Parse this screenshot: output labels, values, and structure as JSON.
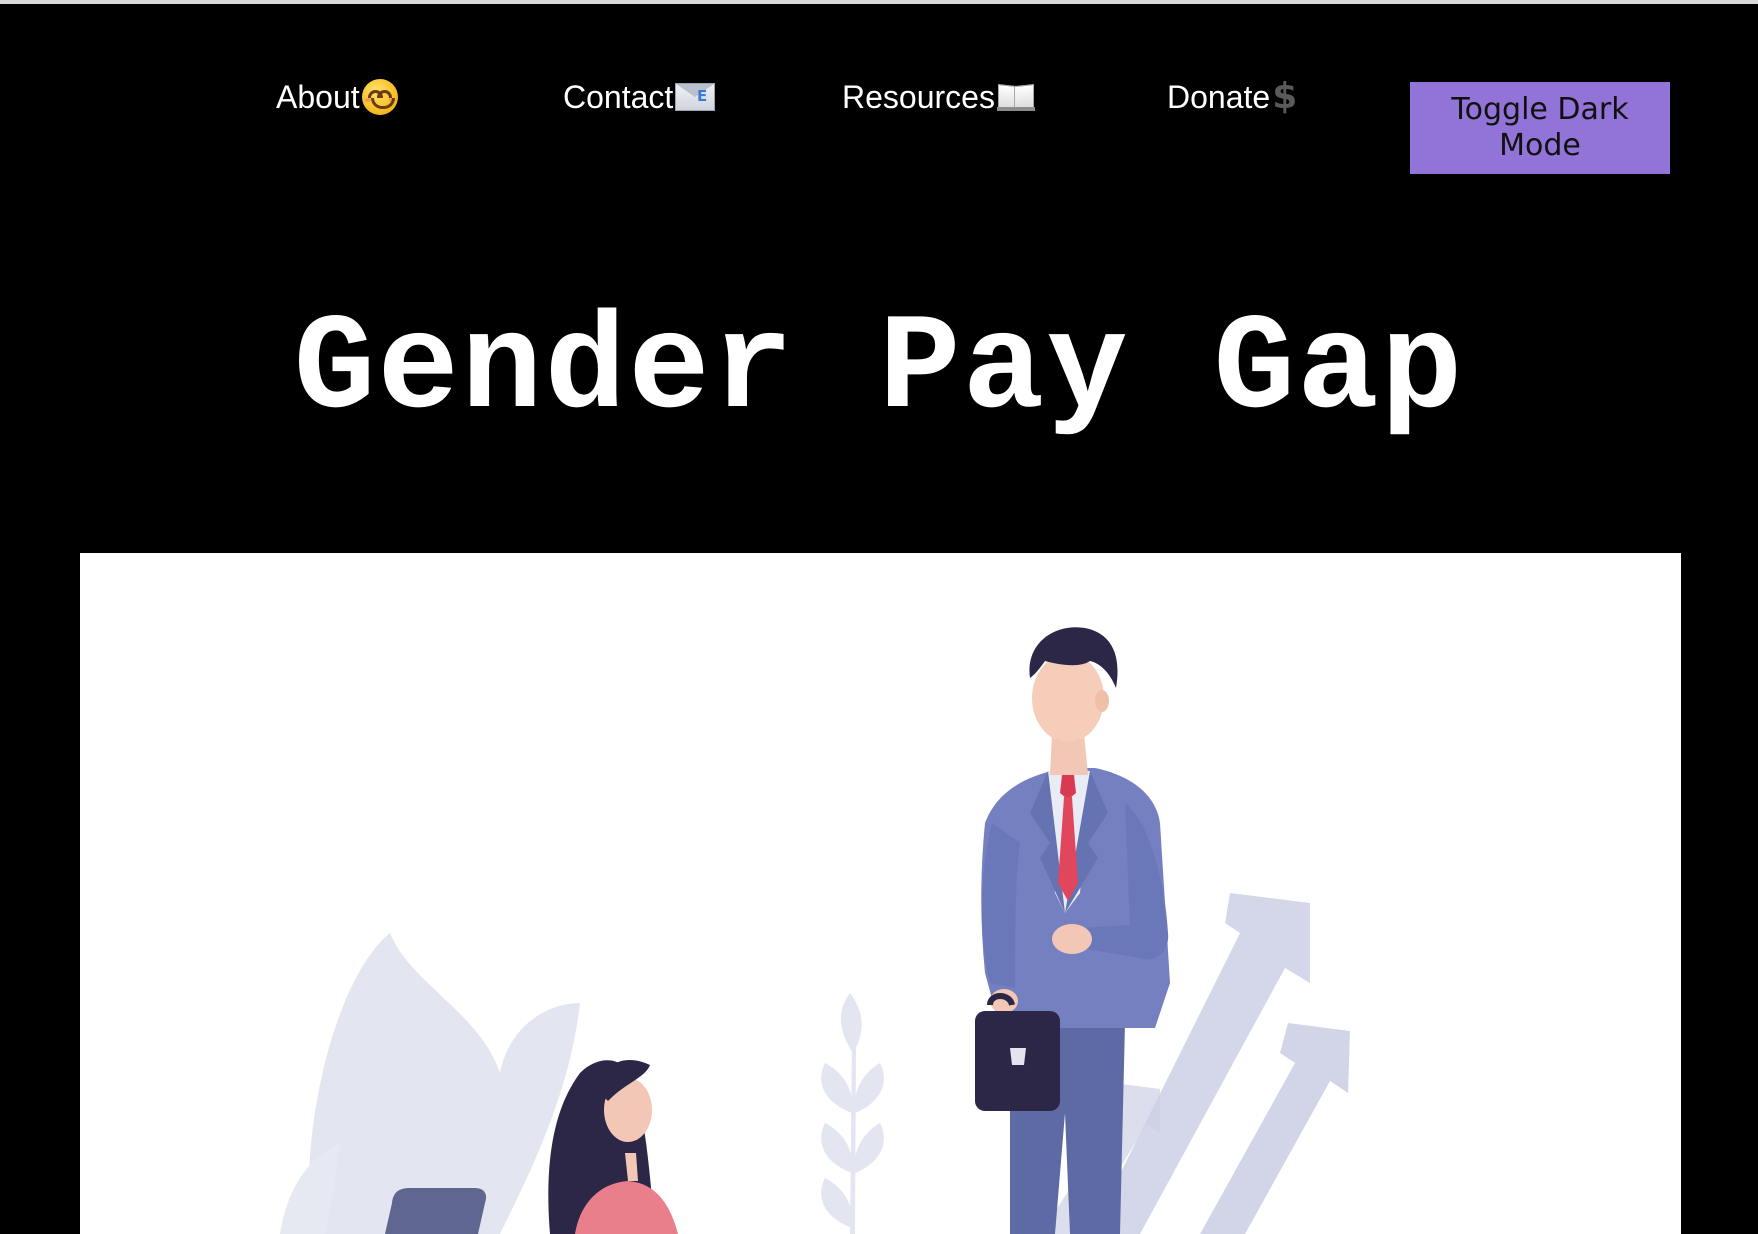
{
  "nav": {
    "items": [
      {
        "label": "About",
        "icon": "smiley-face-icon"
      },
      {
        "label": "Contact",
        "icon": "email-envelope-icon"
      },
      {
        "label": "Resources",
        "icon": "open-book-icon"
      },
      {
        "label": "Donate",
        "icon": "dollar-sign-icon"
      }
    ],
    "toggle_label": "Toggle Dark Mode"
  },
  "page": {
    "title": "Gender Pay Gap"
  },
  "hero": {
    "illustration": "businessman-and-businesswoman-pay-gap-illustration"
  },
  "colors": {
    "background": "#000000",
    "text": "#ffffff",
    "toggle_button": "#9274d8",
    "hero_background": "#ffffff",
    "suit": "#7480c0",
    "tie": "#e0475c",
    "decor": "#d6d9ec"
  }
}
